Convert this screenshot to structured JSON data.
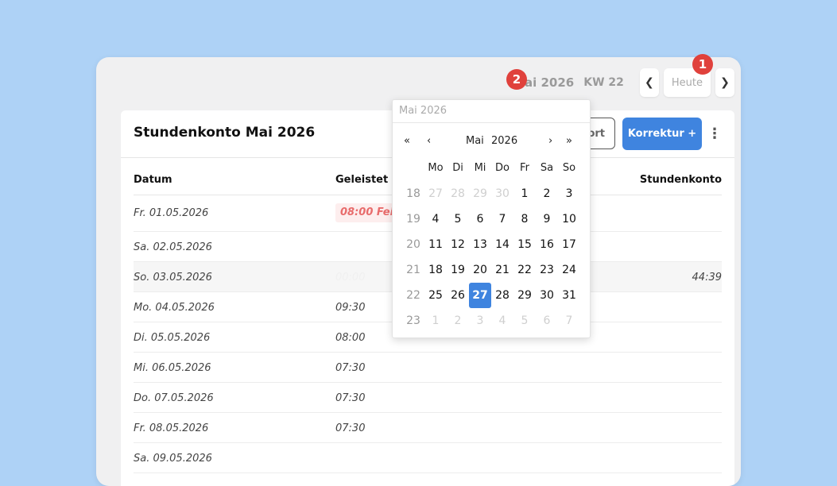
{
  "header": {
    "month_label": "Mai 2026",
    "kw_label": "KW 22",
    "today_label": "Heute",
    "prev_icon": "chevron-left-icon",
    "next_icon": "chevron-right-icon"
  },
  "badges": {
    "one": "1",
    "two": "2"
  },
  "card": {
    "title": "Stundenkonto Mai 2026",
    "export_label": "ort",
    "korrektur_label": "Korrektur +",
    "menu_icon": "kebab-icon"
  },
  "table": {
    "columns": {
      "datum": "Datum",
      "geleistet": "Geleistet",
      "stundenkonto": "Stundenkonto"
    },
    "rows": [
      {
        "date": "Fr. 01.05.2026",
        "geleistet": "08:00 Feier",
        "konto": ""
      },
      {
        "date": "Sa. 02.05.2026",
        "geleistet": "",
        "konto": ""
      },
      {
        "date": "So. 03.05.2026",
        "geleistet": "00:00",
        "konto": "44:39"
      },
      {
        "date": "Mo. 04.05.2026",
        "geleistet": "09:30",
        "konto": ""
      },
      {
        "date": "Di. 05.05.2026",
        "geleistet": "08:00",
        "konto": ""
      },
      {
        "date": "Mi. 06.05.2026",
        "geleistet": "07:30",
        "konto": ""
      },
      {
        "date": "Do. 07.05.2026",
        "geleistet": "07:30",
        "konto": ""
      },
      {
        "date": "Fr. 08.05.2026",
        "geleistet": "07:30",
        "konto": ""
      },
      {
        "date": "Sa. 09.05.2026",
        "geleistet": "",
        "konto": ""
      }
    ]
  },
  "datepicker": {
    "input_value": "Mai 2026",
    "month": "Mai",
    "year": "2026",
    "prev_year_icon": "«",
    "prev_month_icon": "‹",
    "next_month_icon": "›",
    "next_year_icon": "»",
    "weekdays": [
      "Mo",
      "Di",
      "Mi",
      "Do",
      "Fr",
      "Sa",
      "So"
    ],
    "weeks": [
      {
        "kw": "18",
        "days": [
          [
            "27",
            true
          ],
          [
            "28",
            true
          ],
          [
            "29",
            true
          ],
          [
            "30",
            true
          ],
          [
            "1",
            false
          ],
          [
            "2",
            false
          ],
          [
            "3",
            false
          ]
        ]
      },
      {
        "kw": "19",
        "days": [
          [
            "4",
            false
          ],
          [
            "5",
            false
          ],
          [
            "6",
            false
          ],
          [
            "7",
            false
          ],
          [
            "8",
            false
          ],
          [
            "9",
            false
          ],
          [
            "10",
            false
          ]
        ]
      },
      {
        "kw": "20",
        "days": [
          [
            "11",
            false
          ],
          [
            "12",
            false
          ],
          [
            "13",
            false
          ],
          [
            "14",
            false
          ],
          [
            "15",
            false
          ],
          [
            "16",
            false
          ],
          [
            "17",
            false
          ]
        ]
      },
      {
        "kw": "21",
        "days": [
          [
            "18",
            false
          ],
          [
            "19",
            false
          ],
          [
            "20",
            false
          ],
          [
            "21",
            false
          ],
          [
            "22",
            false
          ],
          [
            "23",
            false
          ],
          [
            "24",
            false
          ]
        ]
      },
      {
        "kw": "22",
        "days": [
          [
            "25",
            false
          ],
          [
            "26",
            false
          ],
          [
            "27",
            false
          ],
          [
            "28",
            false
          ],
          [
            "29",
            false
          ],
          [
            "30",
            false
          ],
          [
            "31",
            false
          ]
        ]
      },
      {
        "kw": "23",
        "days": [
          [
            "1",
            true
          ],
          [
            "2",
            true
          ],
          [
            "3",
            true
          ],
          [
            "4",
            true
          ],
          [
            "5",
            true
          ],
          [
            "6",
            true
          ],
          [
            "7",
            true
          ]
        ]
      }
    ],
    "selected": "27"
  }
}
